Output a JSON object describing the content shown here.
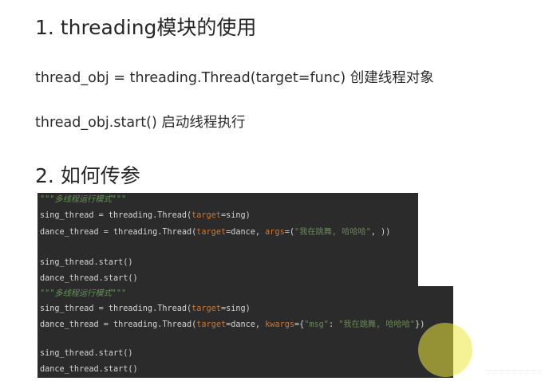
{
  "heading1": "1. threading模块的使用",
  "line1": "thread_obj = threading.Thread(target=func)  创建线程对象",
  "line2": "thread_obj.start() 启动线程执行",
  "heading2": "2. 如何传参",
  "code_block_1": {
    "docstring": "\"\"\"多线程运行模式\"\"\"",
    "sing_prefix": "sing_thread = threading.Thread(",
    "sing_target_kw": "target",
    "sing_target_val": "=sing)",
    "dance_prefix": "dance_thread = threading.Thread(",
    "dance_target_kw": "target",
    "dance_target_val": "=dance, ",
    "dance_args_kw": "args",
    "dance_args_open": "=(",
    "dance_args_str": "\"我在跳舞, 哈哈哈\"",
    "dance_args_close": ", ))",
    "sing_start": "sing_thread.start()",
    "dance_start": "dance_thread.start()"
  },
  "code_block_2": {
    "docstring": "\"\"\"多线程运行模式\"\"\"",
    "sing_prefix": "sing_thread = threading.Thread(",
    "sing_target_kw": "target",
    "sing_target_val": "=sing)",
    "dance_prefix": "dance_thread = threading.Thread(",
    "dance_target_kw": "target",
    "dance_target_val": "=dance, ",
    "dance_kwargs_kw": "kwargs",
    "dance_kwargs_open": "={",
    "dance_kwargs_key": "\"msg\"",
    "dance_kwargs_colon": ": ",
    "dance_kwargs_val": "\"我在跳舞, 哈哈哈\"",
    "dance_kwargs_close": "})",
    "sing_start": "sing_thread.start()",
    "dance_start": "dance_thread.start()"
  },
  "colors": {
    "code_bg": "#2b2b2b",
    "keyword": "#cc7832",
    "string": "#6a8759",
    "docstring": "#629755",
    "cursor_highlight": "#ece840"
  }
}
